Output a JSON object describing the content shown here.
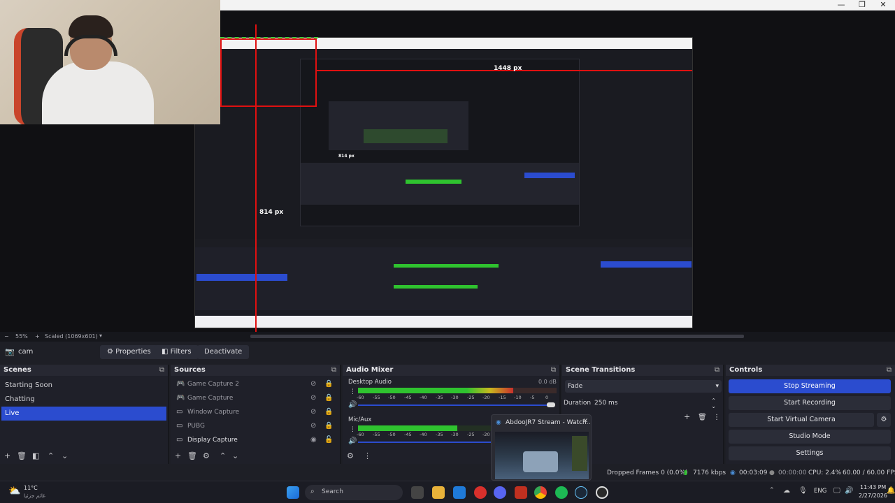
{
  "window": {
    "controls": {
      "minimize": "—",
      "maximize": "❐",
      "close": "✕"
    }
  },
  "preview": {
    "guide_width_label": "1448 px",
    "guide_height_label": "814 px",
    "nested_guide_height_label": "814 px"
  },
  "zoombar": {
    "minus": "−",
    "zoom": "55%",
    "plus": "+",
    "mode": "Scaled (1069x601)"
  },
  "source_toolbar": {
    "source_name": "cam",
    "properties_label": "Properties",
    "filters_label": "Filters",
    "deactivate_label": "Deactivate"
  },
  "scenes": {
    "title": "Scenes",
    "items": [
      {
        "label": "Starting Soon"
      },
      {
        "label": "Chatting"
      },
      {
        "label": "Live"
      }
    ],
    "selected_index": 2
  },
  "sources": {
    "title": "Sources",
    "items": [
      {
        "label": "Game Capture 2",
        "type": "gamepad-icon",
        "visible": false,
        "locked": true,
        "dim": true
      },
      {
        "label": "Game Capture",
        "type": "gamepad-icon",
        "visible": false,
        "locked": true,
        "dim": true
      },
      {
        "label": "Window Capture",
        "type": "window-icon",
        "visible": false,
        "locked": true,
        "dim": true
      },
      {
        "label": "PUBG",
        "type": "window-icon",
        "visible": false,
        "locked": true,
        "dim": true
      },
      {
        "label": "Display Capture",
        "type": "display-icon",
        "visible": true,
        "locked": false,
        "dim": false
      }
    ]
  },
  "audio_mixer": {
    "title": "Audio Mixer",
    "channels": [
      {
        "name": "Desktop Audio",
        "db": "0.0 dB",
        "level": 0.78
      },
      {
        "name": "Mic/Aux",
        "db": "",
        "level": 0.5
      }
    ],
    "scale": [
      "-60",
      "-55",
      "-50",
      "-45",
      "-40",
      "-35",
      "-30",
      "-25",
      "-20",
      "-15",
      "-10",
      "-5",
      "0"
    ]
  },
  "scene_transitions": {
    "title": "Scene Transitions",
    "transition": "Fade",
    "duration_label": "Duration",
    "duration_value": "250 ms"
  },
  "controls": {
    "title": "Controls",
    "stop_streaming": "Stop Streaming",
    "start_recording": "Start Recording",
    "start_virtual_camera": "Start Virtual Camera",
    "studio_mode": "Studio Mode",
    "settings": "Settings"
  },
  "chrome_popup": {
    "title": "AbdooJR7 Stream - Watch..."
  },
  "status": {
    "dropped_frames": "Dropped Frames 0 (0.0%)",
    "bitrate": "7176 kbps",
    "stream_time": "00:03:09",
    "record_time": "00:00:00",
    "cpu": "CPU: 2.4%",
    "fps": "60.00 / 60.00 FPS"
  },
  "taskbar": {
    "weather_temp": "11°C",
    "weather_desc": "غائم جزئيا",
    "search_placeholder": "Search",
    "language": "ENG",
    "time": "11:43 PM",
    "date": "2/27/2026"
  },
  "colors": {
    "accent": "#2b4ccf",
    "meter_green": "#2fc32f",
    "meter_yellow": "#c8b81e",
    "meter_red": "#c9302c",
    "guide_red": "#e01010"
  }
}
